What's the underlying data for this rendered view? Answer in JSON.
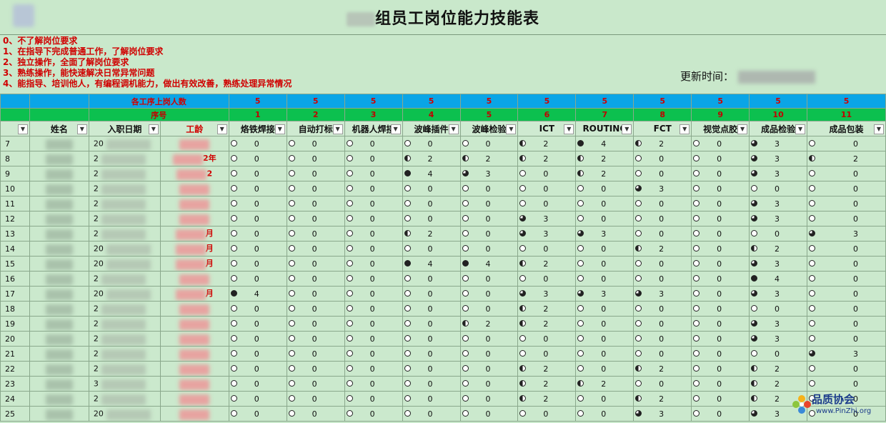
{
  "title": "组员工岗位能力技能表",
  "legend": [
    "0、不了解岗位要求",
    "1、在指导下完成普通工作，了解岗位要求",
    "2、独立操作，全面了解岗位要求",
    "3、熟练操作，能快速解决日常异常问题",
    "4、能指导、培训他人，有编程调机能力，做出有效改善，熟练处理异常情况"
  ],
  "update_label": "更新时间：",
  "count_label": "各工序上岗人数",
  "seq_label": "序号",
  "headers": {
    "name": "姓名",
    "date": "入职日期",
    "seniority": "工龄"
  },
  "skills": [
    {
      "seq": "1",
      "name": "烙铁焊接",
      "count": "5"
    },
    {
      "seq": "2",
      "name": "自动打标",
      "count": "5"
    },
    {
      "seq": "3",
      "name": "机器人焊接",
      "count": "5"
    },
    {
      "seq": "4",
      "name": "波峰插件",
      "count": "5"
    },
    {
      "seq": "5",
      "name": "波峰检验",
      "count": "5"
    },
    {
      "seq": "6",
      "name": "ICT",
      "count": "5"
    },
    {
      "seq": "7",
      "name": "ROUTING",
      "count": "5"
    },
    {
      "seq": "8",
      "name": "FCT",
      "count": "5"
    },
    {
      "seq": "9",
      "name": "视觉点胶",
      "count": "5"
    },
    {
      "seq": "10",
      "name": "成品检验",
      "count": "5"
    },
    {
      "seq": "11",
      "name": "成品包装",
      "count": "5"
    }
  ],
  "rows": [
    {
      "no": "7",
      "date": "20",
      "sen": "",
      "v": [
        0,
        0,
        0,
        0,
        0,
        2,
        4,
        2,
        0,
        3,
        0
      ]
    },
    {
      "no": "8",
      "date": "2",
      "sen": "2年",
      "v": [
        0,
        0,
        0,
        2,
        2,
        2,
        2,
        0,
        0,
        3,
        2
      ]
    },
    {
      "no": "9",
      "date": "2",
      "sen": "2",
      "v": [
        0,
        0,
        0,
        4,
        3,
        0,
        2,
        0,
        0,
        3,
        0
      ]
    },
    {
      "no": "10",
      "date": "2",
      "sen": "",
      "v": [
        0,
        0,
        0,
        0,
        0,
        0,
        0,
        3,
        0,
        0,
        0
      ]
    },
    {
      "no": "11",
      "date": "2",
      "sen": "",
      "v": [
        0,
        0,
        0,
        0,
        0,
        0,
        0,
        0,
        0,
        3,
        0
      ]
    },
    {
      "no": "12",
      "date": "2",
      "sen": "",
      "v": [
        0,
        0,
        0,
        0,
        0,
        3,
        0,
        0,
        0,
        3,
        0
      ]
    },
    {
      "no": "13",
      "date": "2",
      "sen": "月",
      "v": [
        0,
        0,
        0,
        2,
        0,
        3,
        3,
        0,
        0,
        0,
        3
      ]
    },
    {
      "no": "14",
      "date": "20",
      "sen": "月",
      "v": [
        0,
        0,
        0,
        0,
        0,
        0,
        0,
        2,
        0,
        2,
        0
      ]
    },
    {
      "no": "15",
      "date": "20",
      "sen": "月",
      "v": [
        0,
        0,
        0,
        4,
        4,
        2,
        0,
        0,
        0,
        3,
        0
      ]
    },
    {
      "no": "16",
      "date": "2",
      "sen": "",
      "v": [
        0,
        0,
        0,
        0,
        0,
        0,
        0,
        0,
        0,
        4,
        0
      ]
    },
    {
      "no": "17",
      "date": "20",
      "sen": "月",
      "v": [
        4,
        0,
        0,
        0,
        0,
        3,
        3,
        3,
        0,
        3,
        0
      ]
    },
    {
      "no": "18",
      "date": "2",
      "sen": "",
      "v": [
        0,
        0,
        0,
        0,
        0,
        2,
        0,
        0,
        0,
        0,
        0
      ]
    },
    {
      "no": "19",
      "date": "2",
      "sen": "",
      "v": [
        0,
        0,
        0,
        0,
        2,
        2,
        0,
        0,
        0,
        3,
        0
      ]
    },
    {
      "no": "20",
      "date": "2",
      "sen": "",
      "v": [
        0,
        0,
        0,
        0,
        0,
        0,
        0,
        0,
        0,
        3,
        0
      ]
    },
    {
      "no": "21",
      "date": "2",
      "sen": "",
      "v": [
        0,
        0,
        0,
        0,
        0,
        0,
        0,
        0,
        0,
        0,
        3
      ]
    },
    {
      "no": "22",
      "date": "2",
      "sen": "",
      "v": [
        0,
        0,
        0,
        0,
        0,
        2,
        0,
        2,
        0,
        2,
        0
      ]
    },
    {
      "no": "23",
      "date": "3",
      "sen": "",
      "v": [
        0,
        0,
        0,
        0,
        0,
        2,
        2,
        0,
        0,
        2,
        0
      ]
    },
    {
      "no": "24",
      "date": "2",
      "sen": "",
      "v": [
        0,
        0,
        0,
        0,
        0,
        2,
        0,
        2,
        0,
        2,
        0
      ]
    },
    {
      "no": "25",
      "date": "20",
      "sen": "",
      "v": [
        0,
        0,
        0,
        0,
        0,
        0,
        0,
        3,
        0,
        3,
        0
      ]
    }
  ],
  "watermark": {
    "name": "品质协会",
    "url": "www.PinZhi.org"
  }
}
